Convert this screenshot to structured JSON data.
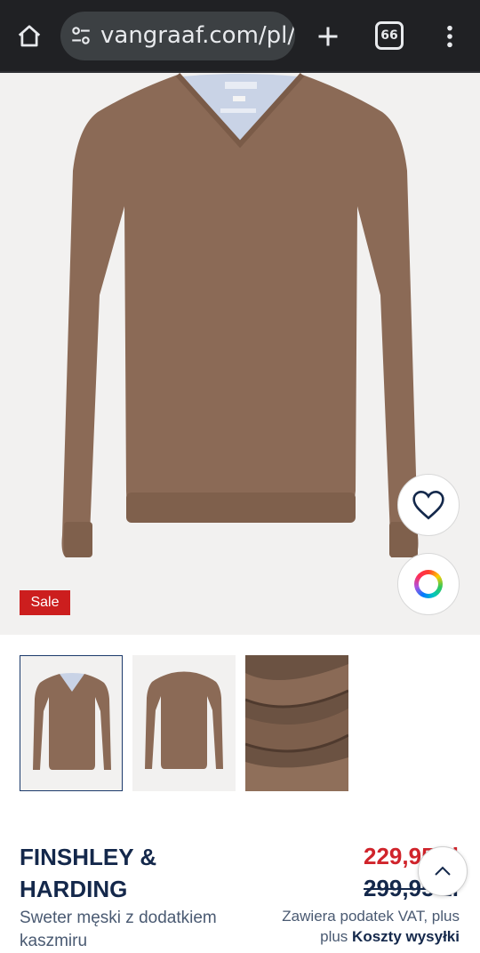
{
  "browser": {
    "url": "vangraaf.com/pl/",
    "tab_count": "66"
  },
  "product": {
    "badge": "Sale",
    "brand": "FINSHLEY & HARDING",
    "description": "Sweter męski z dodatkiem kaszmiru",
    "price_new": "229,95 zł",
    "price_old": "299,95 zł",
    "vat_text": "Zawiera podatek VAT, plus",
    "shipping_prefix": "plus",
    "shipping_link": "Koszty wysyłki"
  },
  "thumbnails": [
    {
      "view": "front",
      "selected": true
    },
    {
      "view": "back",
      "selected": false
    },
    {
      "view": "fabric-detail",
      "selected": false
    }
  ],
  "icons": {
    "home": "home-icon",
    "site_settings": "tune-icon",
    "new_tab": "plus-icon",
    "tabs": "tab-switcher-icon",
    "menu": "more-vert-icon",
    "wishlist": "heart-icon",
    "colors": "color-wheel-icon",
    "scroll_top": "chevron-up-icon"
  },
  "colors": {
    "sale_badge": "#cc1e1e",
    "price_new": "#d0242b",
    "brand_text": "#14284b",
    "sweater": "#8b6a56"
  }
}
